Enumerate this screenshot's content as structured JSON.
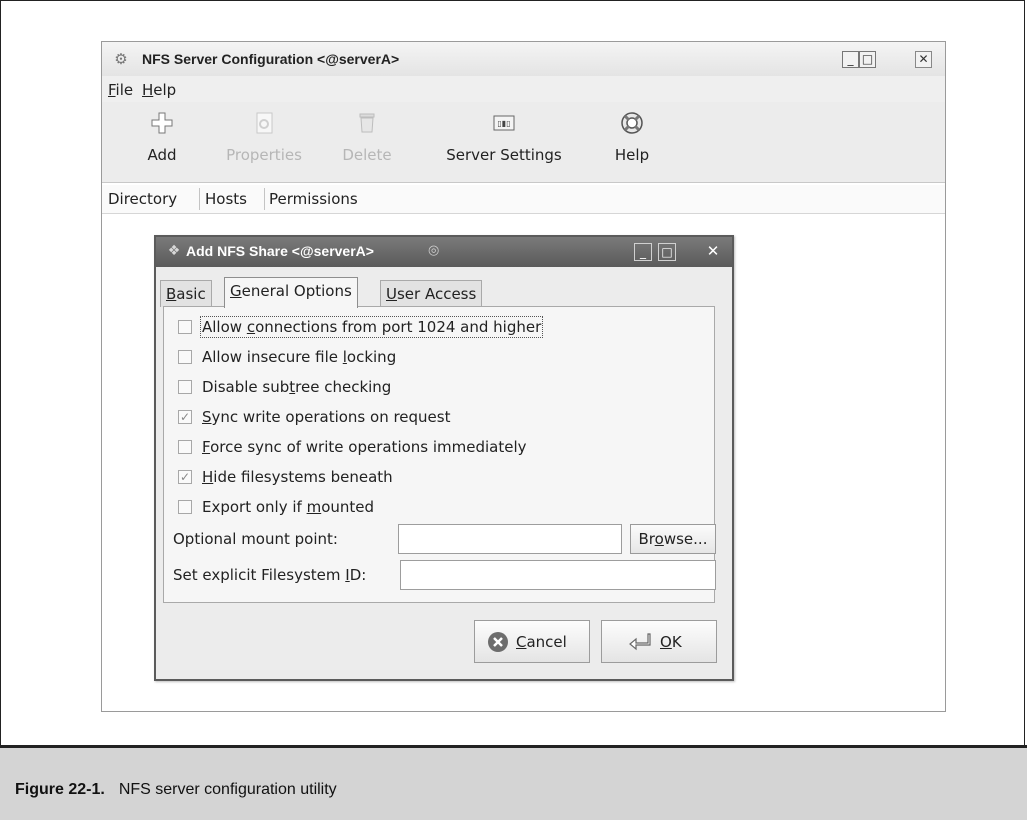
{
  "main_window": {
    "title": "NFS Server Configuration <@serverA>",
    "wm_buttons": {
      "minimize": "_",
      "maximize": "□",
      "close": "✕"
    },
    "menu": [
      {
        "pre": "",
        "mnemonic": "F",
        "post": "ile"
      },
      {
        "pre": "",
        "mnemonic": "H",
        "post": "elp"
      }
    ],
    "toolbar": [
      {
        "label": "Add",
        "icon": "add-icon",
        "enabled": true
      },
      {
        "label": "Properties",
        "icon": "properties-icon",
        "enabled": false
      },
      {
        "label": "Delete",
        "icon": "trash-icon",
        "enabled": false
      },
      {
        "label": "Server Settings",
        "icon": "server-settings-icon",
        "enabled": true
      },
      {
        "label": "Help",
        "icon": "lifebuoy-icon",
        "enabled": true
      }
    ],
    "columns": [
      "Directory",
      "Hosts",
      "Permissions"
    ]
  },
  "dialog": {
    "title": "Add NFS Share <@serverA>",
    "tabs": [
      {
        "pre": "",
        "mnemonic": "B",
        "post": "asic",
        "active": false
      },
      {
        "pre": "",
        "mnemonic": "G",
        "post": "eneral Options",
        "active": true
      },
      {
        "pre": "",
        "mnemonic": "U",
        "post": "ser Access",
        "active": false
      }
    ],
    "options": [
      {
        "pre": "Allow ",
        "mnemonic": "c",
        "post": "onnections from port 1024 and higher",
        "checked": false
      },
      {
        "pre": "Allow insecure file ",
        "mnemonic": "l",
        "post": "ocking",
        "checked": false
      },
      {
        "pre": "Disable sub",
        "mnemonic": "t",
        "post": "ree checking",
        "checked": false
      },
      {
        "pre": "",
        "mnemonic": "S",
        "post": "ync write operations on request",
        "checked": true
      },
      {
        "pre": "",
        "mnemonic": "F",
        "post": "orce sync of write operations immediately",
        "checked": false
      },
      {
        "pre": "",
        "mnemonic": "H",
        "post": "ide filesystems beneath",
        "checked": true
      },
      {
        "pre": "Export only if ",
        "mnemonic": "m",
        "post": "ounted",
        "checked": false
      }
    ],
    "mount_point": {
      "label": "Optional mount point:",
      "value": "",
      "placeholder": ""
    },
    "browse": {
      "pre": "Br",
      "mnemonic": "o",
      "post": "wse..."
    },
    "fsid": {
      "label_pre": "Set explicit Filesystem ",
      "label_mnemonic": "I",
      "label_post": "D:",
      "value": "",
      "placeholder": ""
    },
    "cancel": {
      "pre": "",
      "mnemonic": "C",
      "post": "ancel"
    },
    "ok": {
      "pre": "",
      "mnemonic": "O",
      "post": "K"
    }
  },
  "caption": {
    "number": "Figure 22-1.",
    "text": "NFS server configuration utility"
  }
}
